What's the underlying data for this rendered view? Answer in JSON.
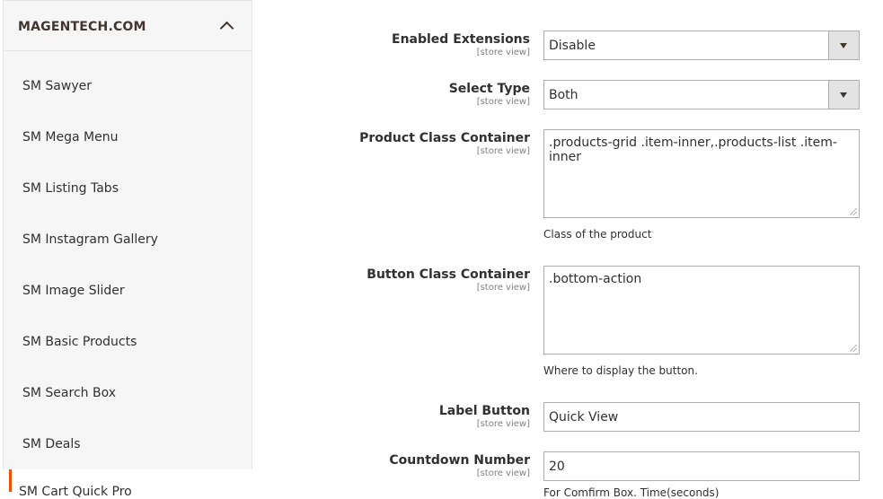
{
  "sidebar": {
    "title": "MAGENTECH.COM",
    "items": [
      {
        "label": "SM Sawyer"
      },
      {
        "label": "SM Mega Menu"
      },
      {
        "label": "SM Listing Tabs"
      },
      {
        "label": "SM Instagram Gallery"
      },
      {
        "label": "SM Image Slider"
      },
      {
        "label": "SM Basic Products"
      },
      {
        "label": "SM Search Box"
      },
      {
        "label": "SM Deals"
      },
      {
        "label": "SM Cart Quick Pro"
      }
    ]
  },
  "form": {
    "enabled_extensions": {
      "label": "Enabled Extensions",
      "scope": "[store view]",
      "value": "Disable"
    },
    "select_type": {
      "label": "Select Type",
      "scope": "[store view]",
      "value": "Both"
    },
    "product_class": {
      "label": "Product Class Container",
      "scope": "[store view]",
      "value": ".products-grid .item-inner,.products-list .item-inner",
      "note": "Class of the product"
    },
    "button_class": {
      "label": "Button Class Container",
      "scope": "[store view]",
      "value": ".bottom-action",
      "note": "Where to display the button."
    },
    "label_button": {
      "label": "Label Button",
      "scope": "[store view]",
      "value": "Quick View"
    },
    "countdown": {
      "label": "Countdown Number",
      "scope": "[store view]",
      "value": "20",
      "note": "For Comfirm Box. Time(seconds)"
    }
  },
  "colors": {
    "accent": "#eb5202"
  }
}
